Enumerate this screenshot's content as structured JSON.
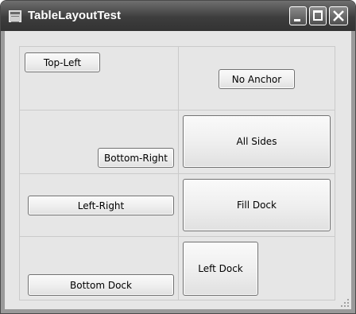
{
  "window": {
    "title": "TableLayoutTest"
  },
  "controls": {
    "minimize_icon": "minimize-icon",
    "maximize_icon": "maximize-icon",
    "close_icon": "close-icon"
  },
  "buttons": {
    "top_left": "Top-Left",
    "no_anchor": "No Anchor",
    "bottom_right": "Bottom-Right",
    "all_sides": "All Sides",
    "left_right": "Left-Right",
    "fill_dock": "Fill Dock",
    "bottom_dock": "Bottom Dock",
    "left_dock": "Left Dock"
  },
  "colors": {
    "titlebar": "#3d3d3d",
    "client": "#e6e6e6",
    "grid_lines": "#cacaca"
  }
}
